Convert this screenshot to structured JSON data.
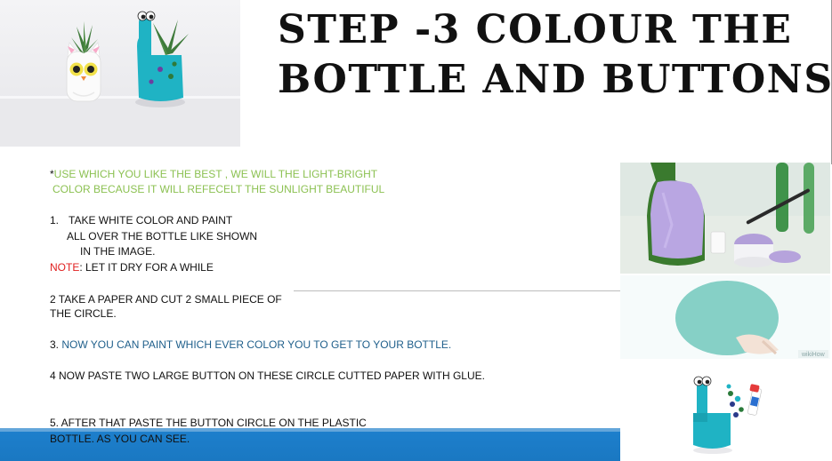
{
  "title": {
    "line1": "STEP -3 COLOUR THE",
    "line2": "BOTTLE AND BUTTONS"
  },
  "intro": {
    "star": "*",
    "line1": "USE WHICH YOU LIKE THE BEST , WE WILL THE LIGHT-BRIGHT",
    "line2": "COLOR BECAUSE IT WILL REFECELT THE SUNLIGHT BEAUTIFUL"
  },
  "step1": {
    "number": "1.",
    "line1": "TAKE WHITE COLOR AND PAINT",
    "line2": "ALL OVER THE BOTTLE LIKE SHOWN",
    "line3": "IN THE IMAGE.",
    "note_label": "NOTE",
    "note_text": ": LET IT DRY FOR A WHILE"
  },
  "step2": {
    "line1": "2 TAKE A PAPER AND CUT 2 SMALL PIECE  OF",
    "line2": "THE CIRCLE."
  },
  "step3": {
    "number": "3. ",
    "text": "NOW YOU CAN PAINT WHICH EVER COLOR YOU TO GET TO YOUR BOTTLE."
  },
  "step4": {
    "text": "4 NOW PASTE TWO LARGE BUTTON ON THESE CIRCLE CUTTED PAPER WITH GLUE."
  },
  "step5": {
    "line1": "5. AFTER THAT PASTE THE BUTTON CIRCLE ON THE PLASTIC",
    "line2": "BOTTLE. AS YOU CAN SEE."
  },
  "watermark": "wikiHow",
  "colors": {
    "green_text": "#8cc152",
    "note_red": "#e02020",
    "step3_blue": "#1f5f8b",
    "footer_bar": "#1d7fcc",
    "turquoise": "#1fb3c4",
    "paper_circle": "#86d0c6"
  }
}
